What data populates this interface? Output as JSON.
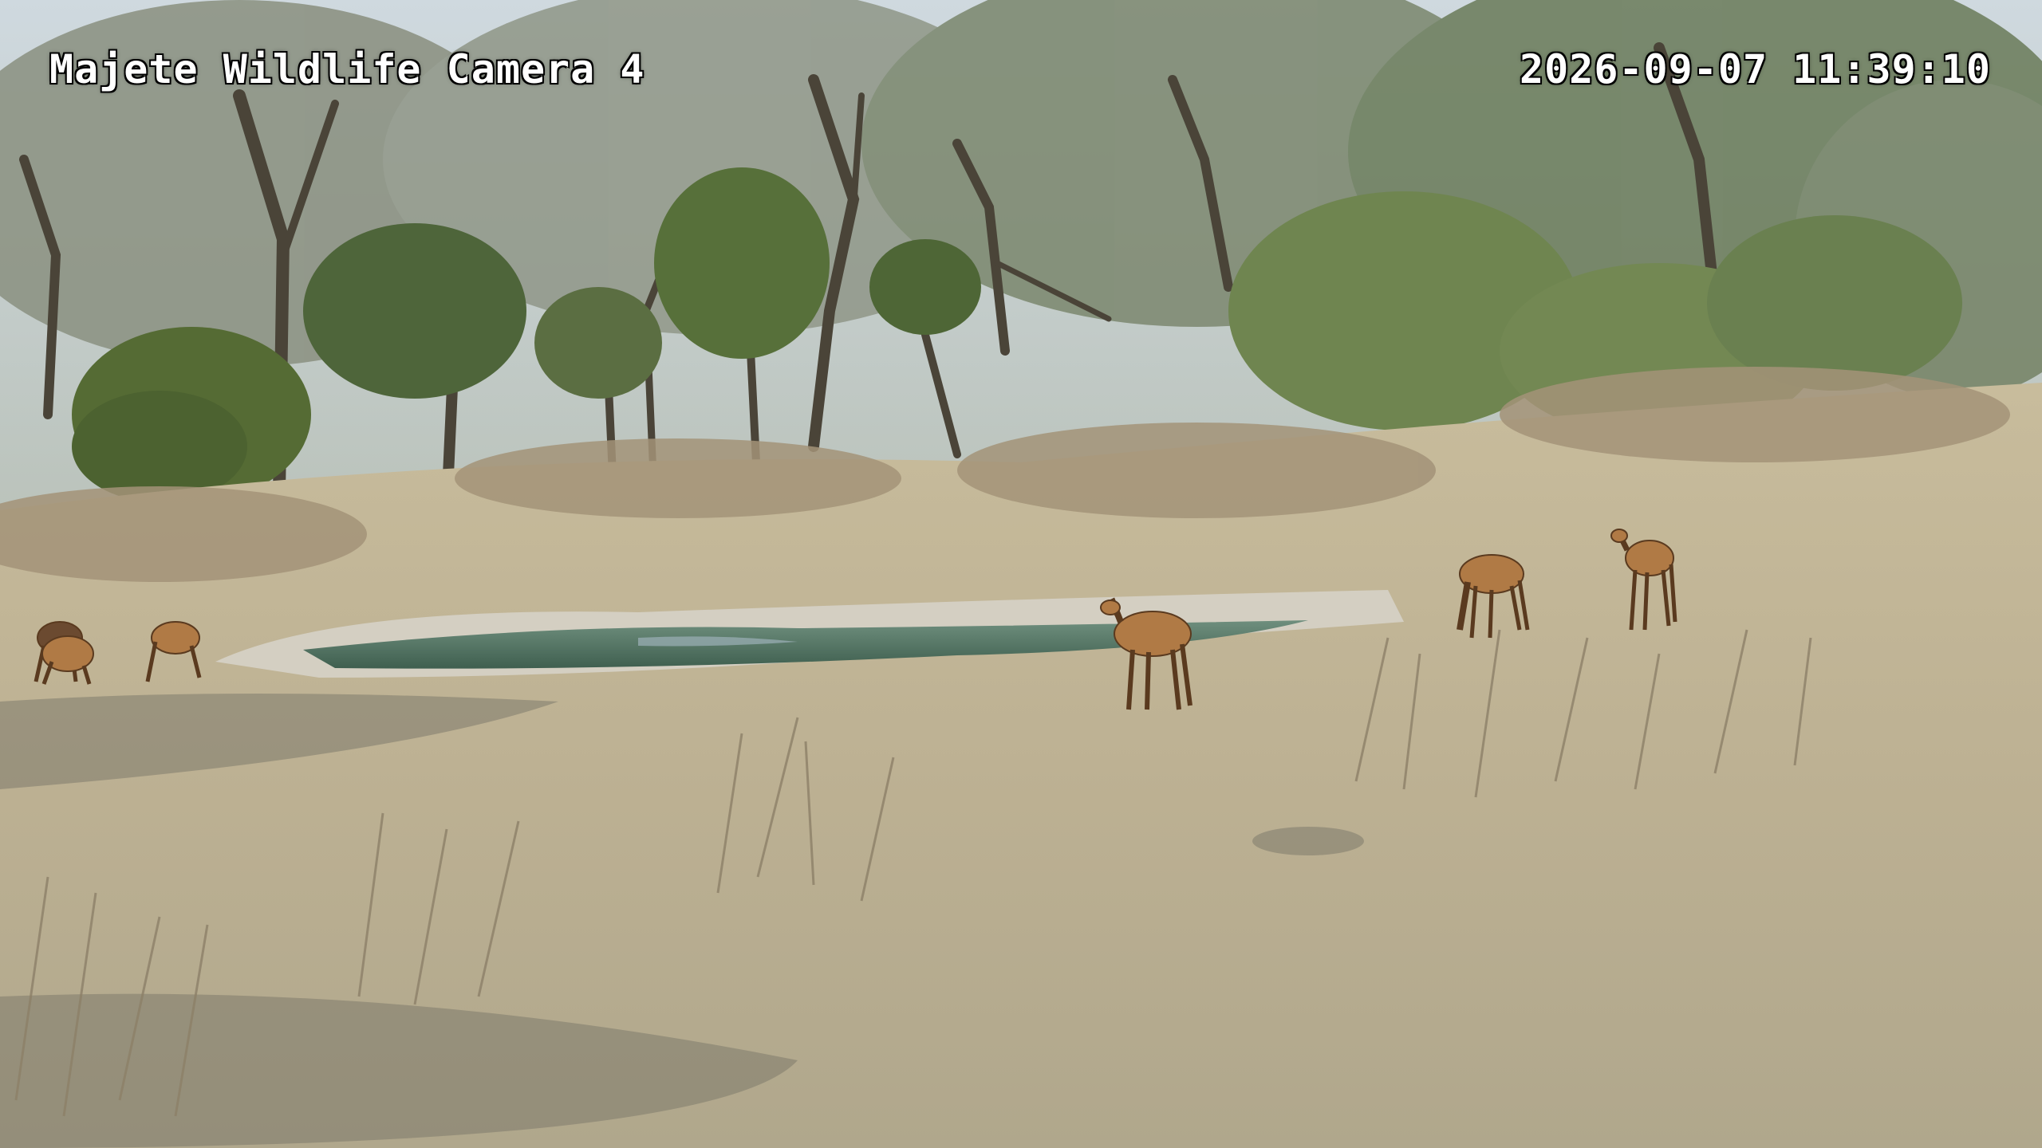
{
  "overlay": {
    "camera_title": "Majete Wildlife Camera 4",
    "timestamp": "2026-09-07 11:39:10"
  },
  "scene": {
    "setting": "dry savanna woodland with small waterhole",
    "animals": [
      {
        "name": "impala",
        "group": "drinking-left"
      },
      {
        "name": "impala",
        "group": "drinking-left"
      },
      {
        "name": "impala",
        "group": "drinking-left"
      },
      {
        "name": "impala",
        "group": "center-standing"
      },
      {
        "name": "impala",
        "group": "right-grazing"
      },
      {
        "name": "impala",
        "group": "right-standing"
      }
    ],
    "colors": {
      "sky": "#d9e2e8",
      "canopy": "#5f7346",
      "grass": "#b8ab88",
      "water": "#4a6a5a",
      "impala": "#b07a45"
    }
  }
}
